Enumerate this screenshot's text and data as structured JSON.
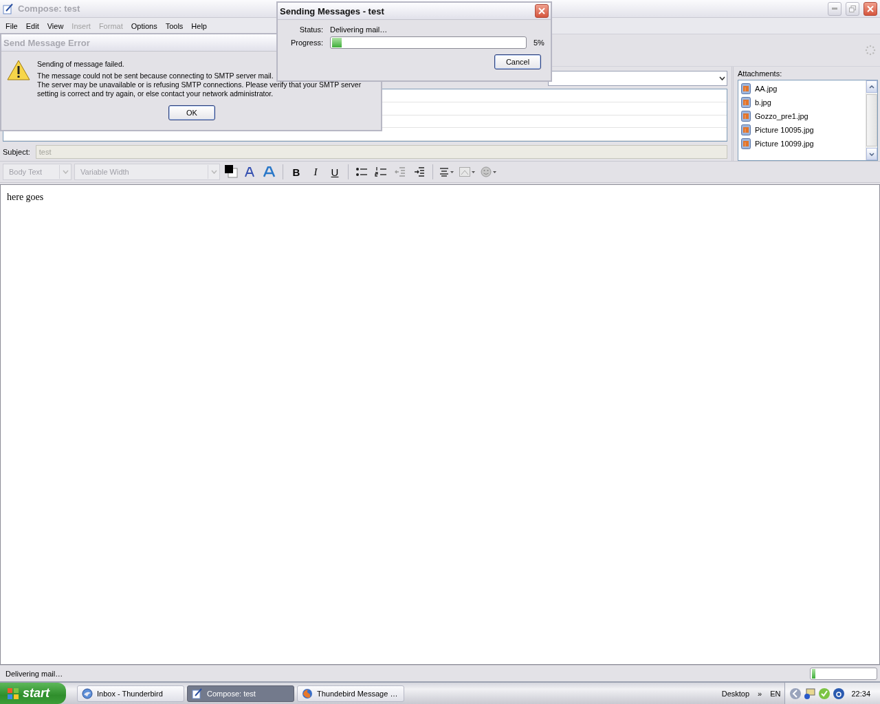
{
  "window": {
    "title": "Compose: test",
    "active": false
  },
  "menu": [
    {
      "label": "File",
      "disabled": false
    },
    {
      "label": "Edit",
      "disabled": false
    },
    {
      "label": "View",
      "disabled": false
    },
    {
      "label": "Insert",
      "disabled": true
    },
    {
      "label": "Format",
      "disabled": true
    },
    {
      "label": "Options",
      "disabled": false
    },
    {
      "label": "Tools",
      "disabled": false
    },
    {
      "label": "Help",
      "disabled": false
    }
  ],
  "subject": {
    "label": "Subject:",
    "value": "test",
    "disabled": true
  },
  "attachments": {
    "label": "Attachments:",
    "items": [
      "AA.jpg",
      "b.jpg",
      "Gozzo_pre1.jpg",
      "Picture 10095.jpg",
      "Picture 10099.jpg"
    ]
  },
  "format_toolbar": {
    "paragraph_style": {
      "value": "Body Text",
      "disabled": true
    },
    "font": {
      "value": "Variable Width",
      "disabled": true
    },
    "groups": [
      [
        {
          "kind": "color"
        },
        {
          "kind": "font-smaller"
        },
        {
          "kind": "font-larger"
        }
      ],
      [
        {
          "kind": "bold",
          "label": "B"
        },
        {
          "kind": "italic",
          "label": "I"
        },
        {
          "kind": "underline",
          "label": "U"
        }
      ],
      [
        {
          "kind": "bullets"
        },
        {
          "kind": "numbers"
        },
        {
          "kind": "outdent"
        },
        {
          "kind": "indent"
        }
      ],
      [
        {
          "kind": "align"
        },
        {
          "kind": "image"
        },
        {
          "kind": "smiley"
        }
      ]
    ]
  },
  "body": {
    "text": "here goes"
  },
  "status_bar": {
    "text": "Delivering mail…",
    "meter": {
      "level": 0.05
    }
  },
  "error_dialog": {
    "title": "Send Message Error",
    "active": false,
    "heading": "Sending of message failed.",
    "message": "The message could not be sent because connecting to SMTP server mail.",
    "detail": "The server may be unavailable or is refusing SMTP connections. Please verify that your SMTP server setting is correct and try again, or else contact your network administrator.",
    "ok_button": "OK"
  },
  "sending_dialog": {
    "title": "Sending Messages - test",
    "active": true,
    "status_label": "Status:",
    "status": "Delivering mail…",
    "progress_label": "Progress:",
    "progress": {
      "level": 0.05
    },
    "percent": "5%",
    "cancel_button": "Cancel"
  },
  "taskbar": {
    "start": "start",
    "tasks": [
      {
        "label": "Inbox - Thunderbird",
        "kind": "thunderbird",
        "selected": false
      },
      {
        "label": "Compose: test",
        "kind": "compose",
        "selected": true
      },
      {
        "label": "Thundebird Message …",
        "kind": "firefox",
        "selected": false
      }
    ],
    "tray": {
      "desktop": "Desktop",
      "chevron": "»",
      "language": "EN",
      "clock": "22:34"
    }
  }
}
